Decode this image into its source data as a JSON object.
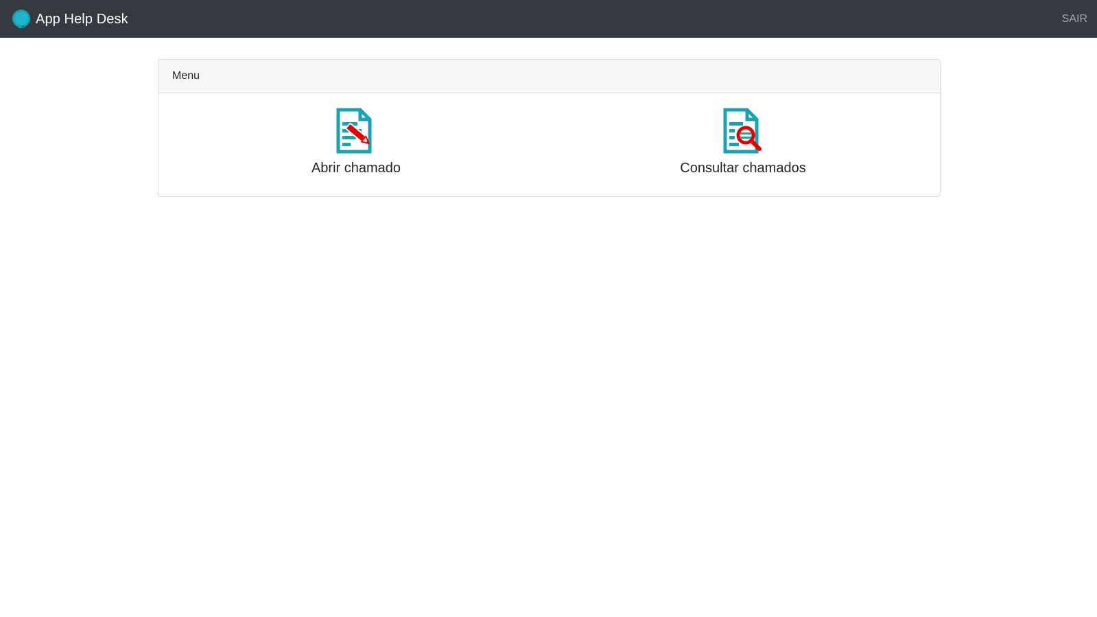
{
  "navbar": {
    "brand_icon": "headset-support-icon",
    "brand_title": "App Help Desk",
    "logout_label": "SAIR"
  },
  "menu_card": {
    "header": "Menu",
    "options": [
      {
        "label": "Abrir chamado",
        "icon": "document-edit-icon"
      },
      {
        "label": "Consultar chamados",
        "icon": "document-search-icon"
      }
    ]
  },
  "colors": {
    "navbar_bg": "#343a40",
    "icon_teal": "#17a2b8",
    "icon_red": "#e60000",
    "card_header_bg": "#f7f7f7"
  }
}
